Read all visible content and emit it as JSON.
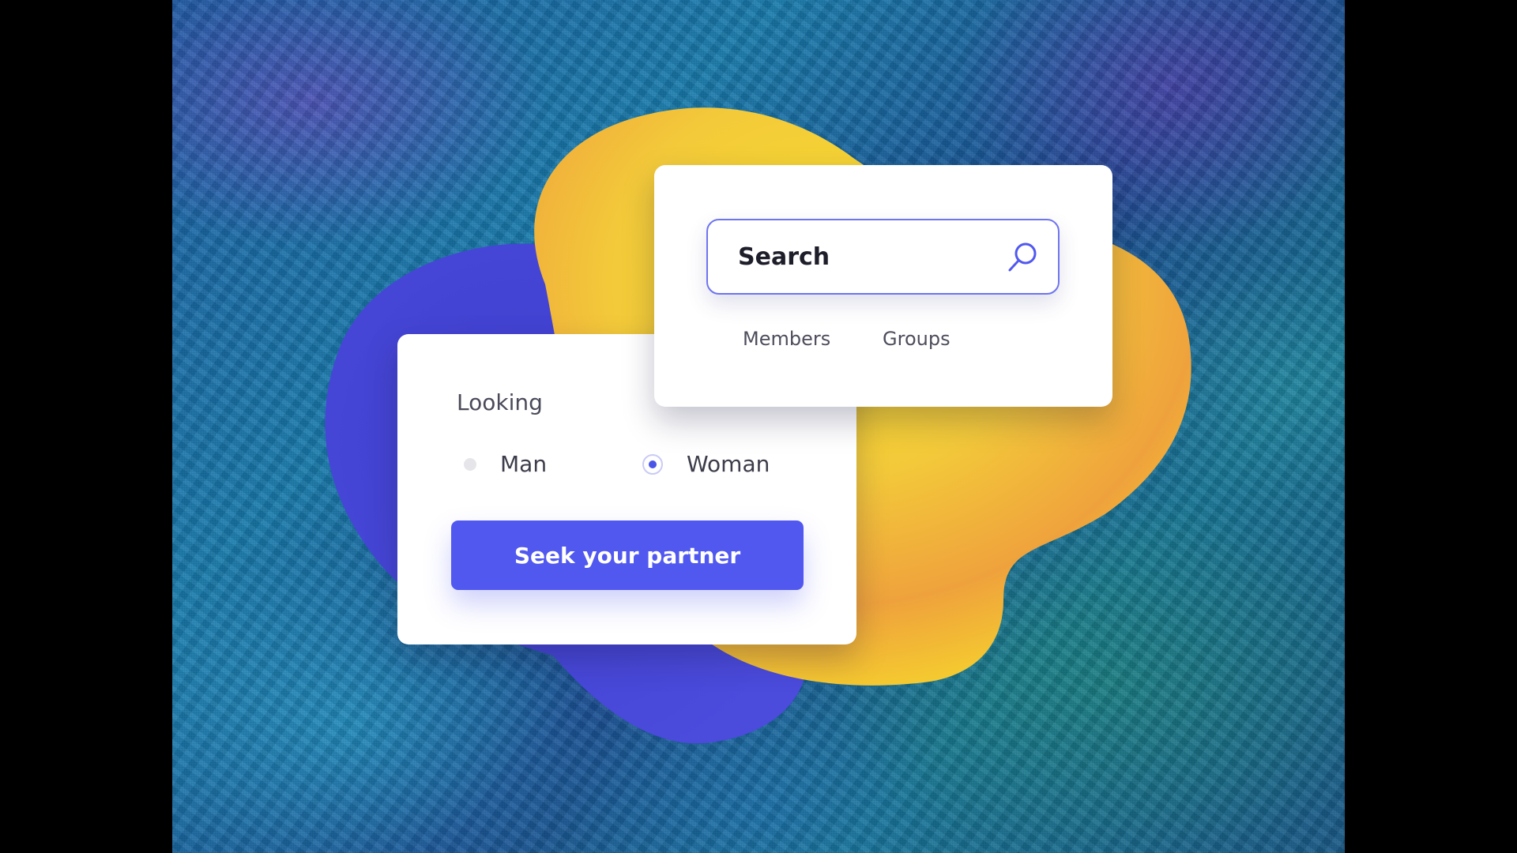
{
  "colors": {
    "accent": "#5158ef",
    "search_border": "#6e74f0",
    "blob_yellow": "#f5d629",
    "blob_orange": "#f0a23a",
    "blob_blue": "#4a46d8",
    "background_painting": "#1d6fa8"
  },
  "looking_card": {
    "title": "Looking",
    "options": [
      {
        "label": "Man",
        "selected": false
      },
      {
        "label": "Woman",
        "selected": true
      }
    ],
    "button_label": "Seek your partner"
  },
  "search_card": {
    "search": {
      "value": "Search",
      "icon": "search-icon"
    },
    "tabs": [
      {
        "label": "Members"
      },
      {
        "label": "Groups"
      }
    ]
  }
}
